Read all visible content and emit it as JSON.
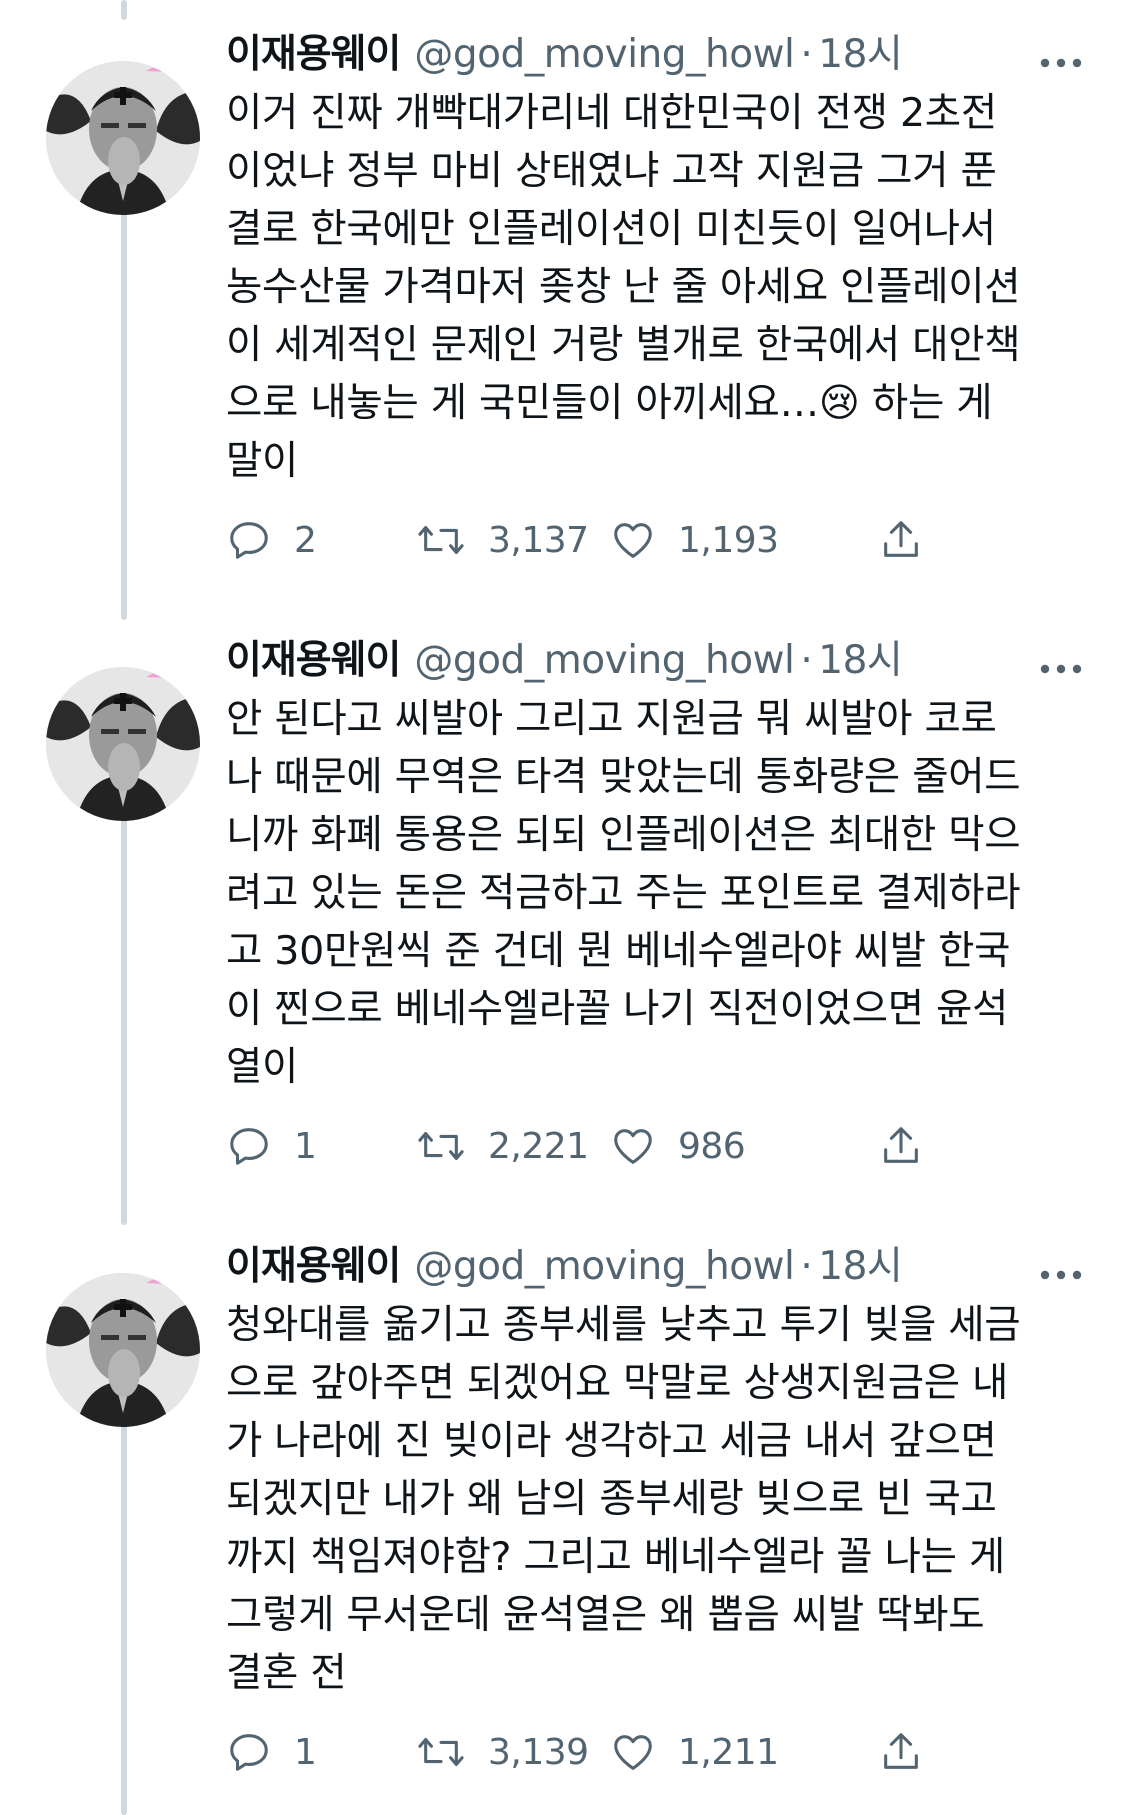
{
  "colors": {
    "text": "#0f1419",
    "secondary": "#536471",
    "thread_line": "#cfd9de"
  },
  "tweets": [
    {
      "display_name": "이재용웨이",
      "handle": "@god_moving_howl",
      "separator": "·",
      "time": "18시",
      "avatar_icon": "profile-avatar",
      "more_icon": "more-horizontal-icon",
      "lines": [
        "이거 진짜 개빡대가리네 대한민국이 전쟁 2초전",
        "이었냐 정부 마비 상태였냐 고작 지원금 그거 푼",
        "결로 한국에만 인플레이션이 미친듯이 일어나서",
        "농수산물 가격마저 좆창 난 줄 아세요 인플레이션",
        "이 세계적인 문제인 거랑 별개로 한국에서 대안책",
        "으로 내놓는 게 국민들이 아끼세요…😢 하는 게",
        "말이"
      ],
      "replies": "2",
      "retweets": "3,137",
      "likes": "1,193"
    },
    {
      "display_name": "이재용웨이",
      "handle": "@god_moving_howl",
      "separator": "·",
      "time": "18시",
      "avatar_icon": "profile-avatar",
      "more_icon": "more-horizontal-icon",
      "lines": [
        "안 된다고 씨발아 그리고 지원금 뭐 씨발아 코로",
        "나 때문에 무역은 타격 맞았는데 통화량은 줄어드",
        "니까 화폐 통용은 되되 인플레이션은 최대한 막으",
        "려고 있는 돈은 적금하고 주는 포인트로 결제하라",
        "고 30만원씩 준 건데 뭔 베네수엘라야 씨발 한국",
        "이 찐으로 베네수엘라꼴 나기 직전이었으면 윤석",
        "열이"
      ],
      "replies": "1",
      "retweets": "2,221",
      "likes": "986"
    },
    {
      "display_name": "이재용웨이",
      "handle": "@god_moving_howl",
      "separator": "·",
      "time": "18시",
      "avatar_icon": "profile-avatar",
      "more_icon": "more-horizontal-icon",
      "lines": [
        "청와대를 옮기고 종부세를 낮추고 투기 빚을 세금",
        "으로 갚아주면 되겠어요 막말로 상생지원금은 내",
        "가 나라에 진 빚이라 생각하고 세금 내서 갚으면",
        "되겠지만 내가 왜 남의 종부세랑 빚으로 빈 국고",
        "까지 책임져야함? 그리고 베네수엘라 꼴 나는 게",
        "그렇게 무서운데 윤석열은 왜 뽑음 씨발 딱봐도",
        "결혼 전"
      ],
      "replies": "1",
      "retweets": "3,139",
      "likes": "1,211"
    }
  ],
  "action_icons": {
    "reply": "reply-bubble-icon",
    "retweet": "retweet-icon",
    "like": "heart-icon",
    "share": "share-upload-icon"
  }
}
